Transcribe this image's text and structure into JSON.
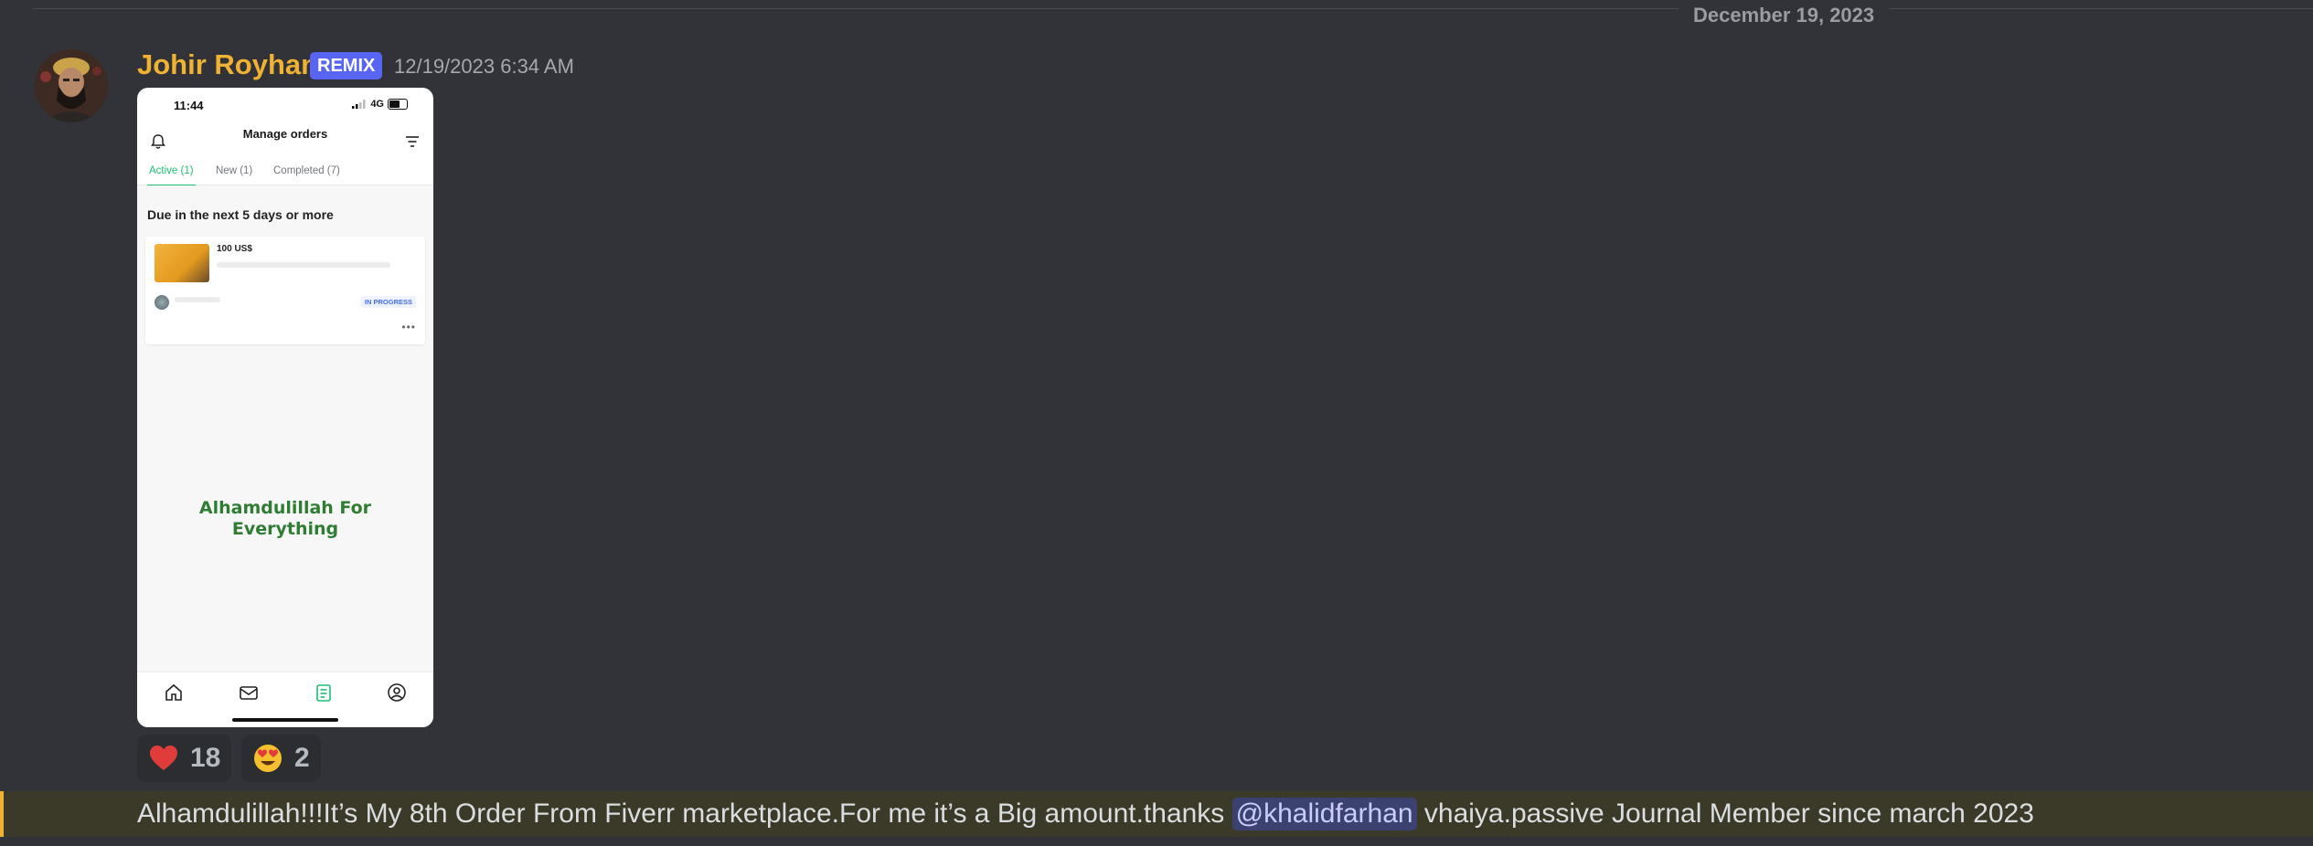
{
  "divider": {
    "date": "December 19, 2023"
  },
  "message": {
    "username": "Johir Royhan",
    "role_tag": "REMIX",
    "timestamp": "12/19/2023 6:34 AM",
    "text_before": "Alhamdulillah!!!It’s My 8th Order From Fiverr marketplace.For me it’s a Big amount.thanks ",
    "mention": "@khalidfarhan",
    "text_after": " vhaiya.passive Journal Member since march 2023"
  },
  "attachment": {
    "status_time": "11:44",
    "network": "4G",
    "title": "Manage orders",
    "tabs": [
      {
        "label": "Active (1)",
        "active": true
      },
      {
        "label": "New (1)",
        "active": false
      },
      {
        "label": "Completed (7)",
        "active": false
      }
    ],
    "due_heading": "Due in the next 5 days or more",
    "order": {
      "price": "100 US$",
      "status": "IN PROGRESS"
    },
    "overlay_quote_line1": "Alhamdulillah For",
    "overlay_quote_line2": "Everything",
    "nav_icons": [
      "home-icon",
      "inbox-icon",
      "orders-icon",
      "profile-icon"
    ]
  },
  "reactions": [
    {
      "emoji": "heart-emoji",
      "count": "18",
      "color": "#e03c3c"
    },
    {
      "emoji": "heart-eyes-emoji",
      "count": "2",
      "color": "#f5c02e"
    }
  ],
  "colors": {
    "background": "#313338",
    "username": "#f0b232",
    "tag": "#5865f2",
    "highlight": "#3b3928",
    "mention_bg": "#3c4270",
    "fiverr_green": "#1dbf73"
  }
}
